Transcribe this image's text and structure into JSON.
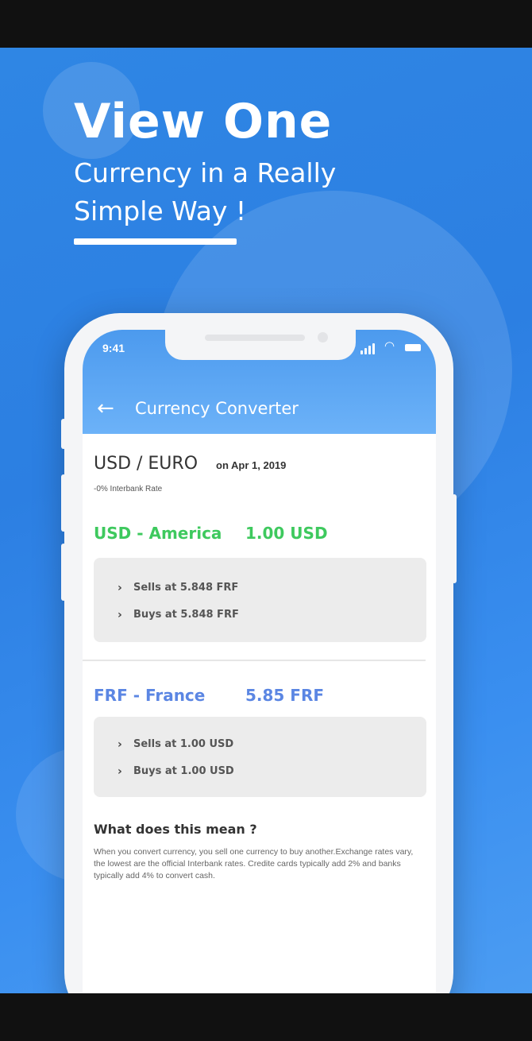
{
  "promo": {
    "headline": "View One",
    "subline": "Currency in a Really Simple Way !"
  },
  "status_bar": {
    "time": "9:41",
    "icons": [
      "signal-icon",
      "wifi-icon",
      "battery-icon"
    ]
  },
  "app_bar": {
    "back_icon": "back-arrow-icon",
    "title": "Currency Converter"
  },
  "conversion": {
    "pair": "USD / EURO",
    "date": "on Apr 1, 2019",
    "rate_note": "-0% Interbank Rate"
  },
  "currencies": [
    {
      "name": "USD - America",
      "amount": "1.00 USD",
      "color": "#3ec95e",
      "rates": [
        "Sells at 5.848 FRF",
        "Buys at 5.848 FRF"
      ]
    },
    {
      "name": "FRF - France",
      "amount": "5.85 FRF",
      "color": "#5b86e3",
      "rates": [
        "Sells at 1.00 USD",
        "Buys at 1.00 USD"
      ]
    }
  ],
  "explanation": {
    "title": "What does this mean ?",
    "body": "When you convert currency, you sell one currency to buy another.Exchange rates vary, the lowest are the official Interbank rates. Credite cards  typically add 2% and banks  typically add 4% to convert cash."
  }
}
